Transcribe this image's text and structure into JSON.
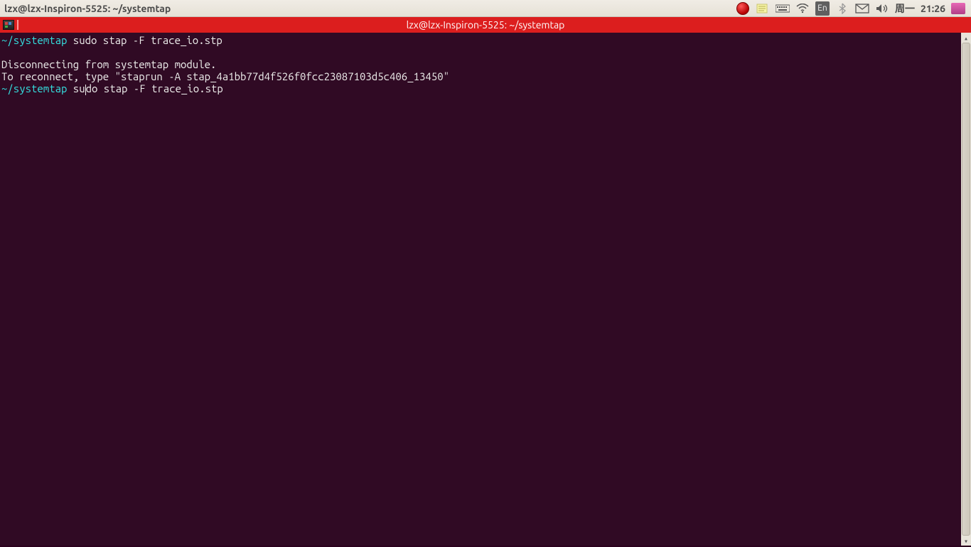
{
  "menubar": {
    "title": "lzx@lzx-Inspiron-5525: ~/systemtap",
    "tray": {
      "ime": "En",
      "day": "周一",
      "time": "21:26"
    }
  },
  "terminal": {
    "title": "lzx@lzx-Inspiron-5525: ~/systemtap",
    "lines": [
      {
        "prompt": "~/systemtap",
        "cmd": " sudo stap -F trace_io.stp"
      },
      {
        "output": ""
      },
      {
        "output": "Disconnecting from systemtap module."
      },
      {
        "output": "To reconnect, type \"staprun -A stap_4a1bb77d4f526f0fcc23087103d5c406_13450\""
      },
      {
        "prompt": "~/systemtap",
        "cmd": " sudo stap -F trace_io.stp",
        "cursor_after_chars": 3
      }
    ]
  }
}
